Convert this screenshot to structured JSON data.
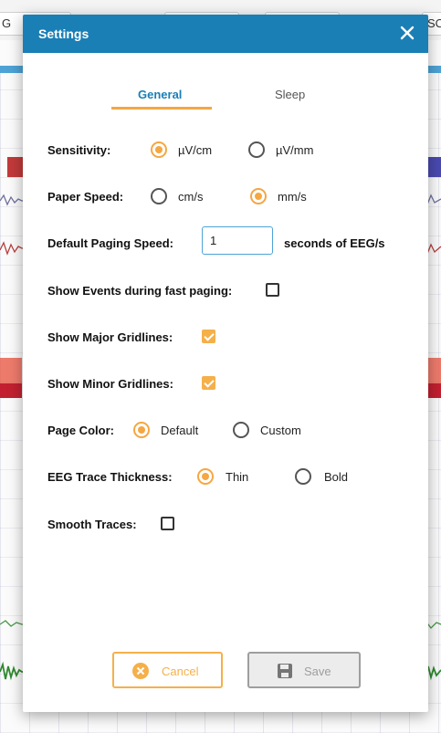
{
  "background": {
    "tab_text_left": "G",
    "tab_text_right": "SC"
  },
  "dialog": {
    "title": "Settings",
    "close_icon": "close-icon",
    "tabs": [
      {
        "label": "General",
        "active": true
      },
      {
        "label": "Sleep",
        "active": false
      }
    ],
    "sensitivity": {
      "label": "Sensitivity:",
      "options": [
        {
          "label": "µV/cm",
          "checked": true
        },
        {
          "label": "µV/mm",
          "checked": false
        }
      ]
    },
    "paper_speed": {
      "label": "Paper Speed:",
      "options": [
        {
          "label": "cm/s",
          "checked": false
        },
        {
          "label": "mm/s",
          "checked": true
        }
      ]
    },
    "paging_speed": {
      "label": "Default Paging Speed:",
      "value": "1",
      "suffix": "seconds of EEG/s"
    },
    "show_events": {
      "label": "Show Events during fast paging:",
      "checked": false
    },
    "major_gridlines": {
      "label": "Show Major Gridlines:",
      "checked": true
    },
    "minor_gridlines": {
      "label": "Show Minor Gridlines:",
      "checked": true
    },
    "page_color": {
      "label": "Page Color:",
      "options": [
        {
          "label": "Default",
          "checked": true
        },
        {
          "label": "Custom",
          "checked": false
        }
      ]
    },
    "trace_thickness": {
      "label": "EEG Trace Thickness:",
      "options": [
        {
          "label": "Thin",
          "checked": true
        },
        {
          "label": "Bold",
          "checked": false
        }
      ]
    },
    "smooth_traces": {
      "label": "Smooth Traces:",
      "checked": false
    },
    "buttons": {
      "cancel": {
        "label": "Cancel",
        "icon": "cancel-circle-icon"
      },
      "save": {
        "label": "Save",
        "icon": "floppy-disk-icon",
        "enabled": false
      }
    }
  },
  "colors": {
    "titlebar": "#1a7fb5",
    "accent": "#f5a742",
    "input_border": "#4ea3d6"
  }
}
